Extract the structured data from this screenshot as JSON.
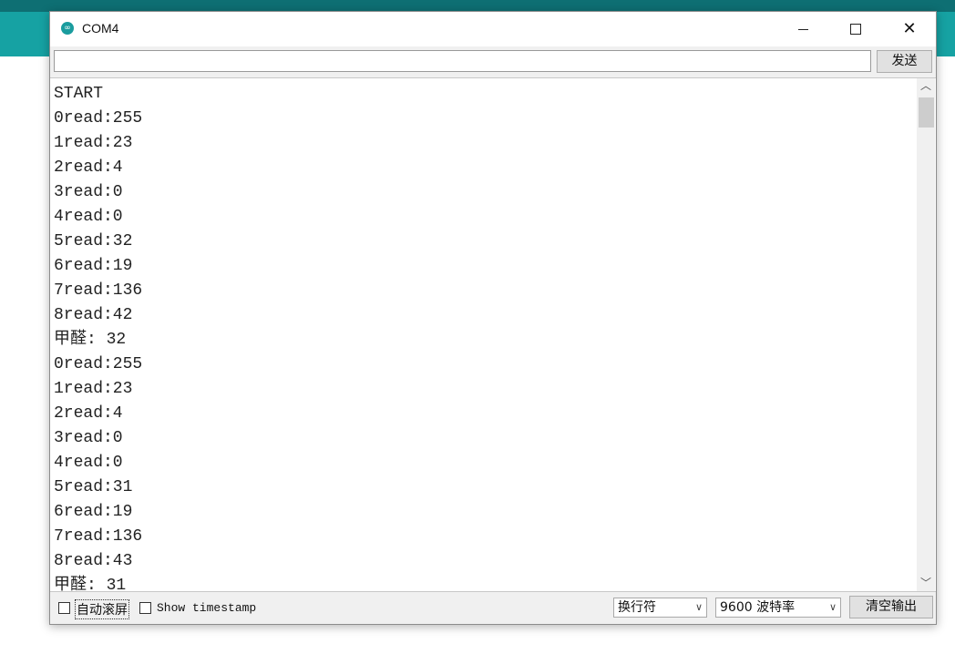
{
  "window": {
    "title": "COM4",
    "icon": "arduino-icon",
    "icon_glyph": "∞",
    "close_glyph": "✕"
  },
  "toolbar": {
    "input_value": "",
    "send_label": "发送"
  },
  "output": {
    "lines": [
      "START",
      "0read:255",
      "1read:23",
      "2read:4",
      "3read:0",
      "4read:0",
      "5read:32",
      "6read:19",
      "7read:136",
      "8read:42",
      "甲醛: 32",
      "0read:255",
      "1read:23",
      "2read:4",
      "3read:0",
      "4read:0",
      "5read:31",
      "6read:19",
      "7read:136",
      "8read:43",
      "甲醛: 31"
    ]
  },
  "scrollbar": {
    "up_glyph": "︿",
    "down_glyph": "﹀"
  },
  "status": {
    "autoscroll_label": "自动滚屏",
    "autoscroll_checked": false,
    "timestamp_label": "Show timestamp",
    "timestamp_checked": false,
    "line_ending_selected": "换行符",
    "baud_selected": "9600 波特率",
    "chevron_glyph": "∨",
    "clear_label": "清空输出"
  },
  "colors": {
    "accent_teal": "#16a2a3",
    "accent_teal_dark": "#0e6f73"
  }
}
